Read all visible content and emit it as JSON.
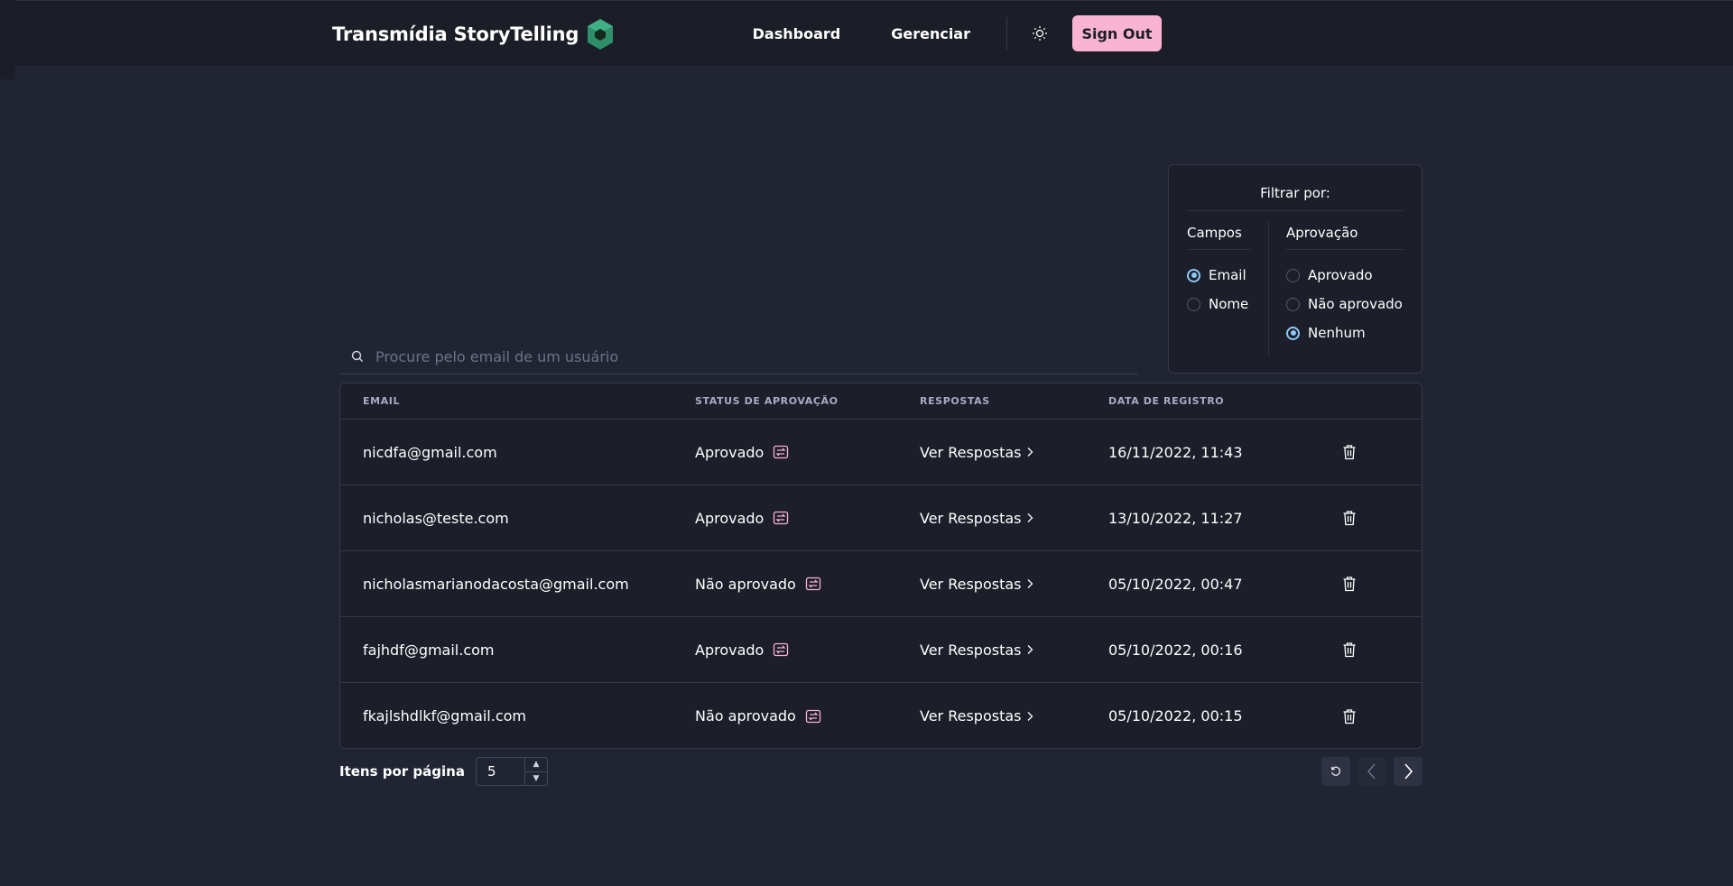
{
  "header": {
    "brand": "Transmídia StoryTelling",
    "nav": [
      {
        "label": "Dashboard"
      },
      {
        "label": "Gerenciar"
      }
    ],
    "sign_out_label": "Sign Out",
    "accent_color": "#f9b4d2"
  },
  "filter": {
    "title": "Filtrar por:",
    "campos": {
      "heading": "Campos",
      "options": [
        {
          "label": "Email",
          "selected": true
        },
        {
          "label": "Nome",
          "selected": false
        }
      ]
    },
    "aprovacao": {
      "heading": "Aprovação",
      "options": [
        {
          "label": "Aprovado",
          "selected": false
        },
        {
          "label": "Não aprovado",
          "selected": false
        },
        {
          "label": "Nenhum",
          "selected": true
        }
      ]
    }
  },
  "search": {
    "placeholder": "Procure pelo email de um usuário",
    "value": ""
  },
  "table": {
    "columns": [
      "EMAIL",
      "STATUS DE APROVAÇÃO",
      "RESPOSTAS",
      "DATA DE REGISTRO"
    ],
    "rows": [
      {
        "email": "nicdfa@gmail.com",
        "status": "Aprovado",
        "responses": "Ver Respostas",
        "date": "16/11/2022, 11:43"
      },
      {
        "email": "nicholas@teste.com",
        "status": "Aprovado",
        "responses": "Ver Respostas",
        "date": "13/10/2022, 11:27"
      },
      {
        "email": "nicholasmarianodacosta@gmail.com",
        "status": "Não aprovado",
        "responses": "Ver Respostas",
        "date": "05/10/2022, 00:47"
      },
      {
        "email": "fajhdf@gmail.com",
        "status": "Aprovado",
        "responses": "Ver Respostas",
        "date": "05/10/2022, 00:16"
      },
      {
        "email": "fkajlshdlkf@gmail.com",
        "status": "Não aprovado",
        "responses": "Ver Respostas",
        "date": "05/10/2022, 00:15"
      }
    ]
  },
  "pagination": {
    "per_page_label": "Itens por página",
    "per_page_value": "5"
  },
  "icons": {
    "swap": "swap-icon",
    "trash": "trash-icon",
    "chevron": "chevron-right-icon",
    "theme": "sun-icon",
    "search": "search-icon"
  }
}
